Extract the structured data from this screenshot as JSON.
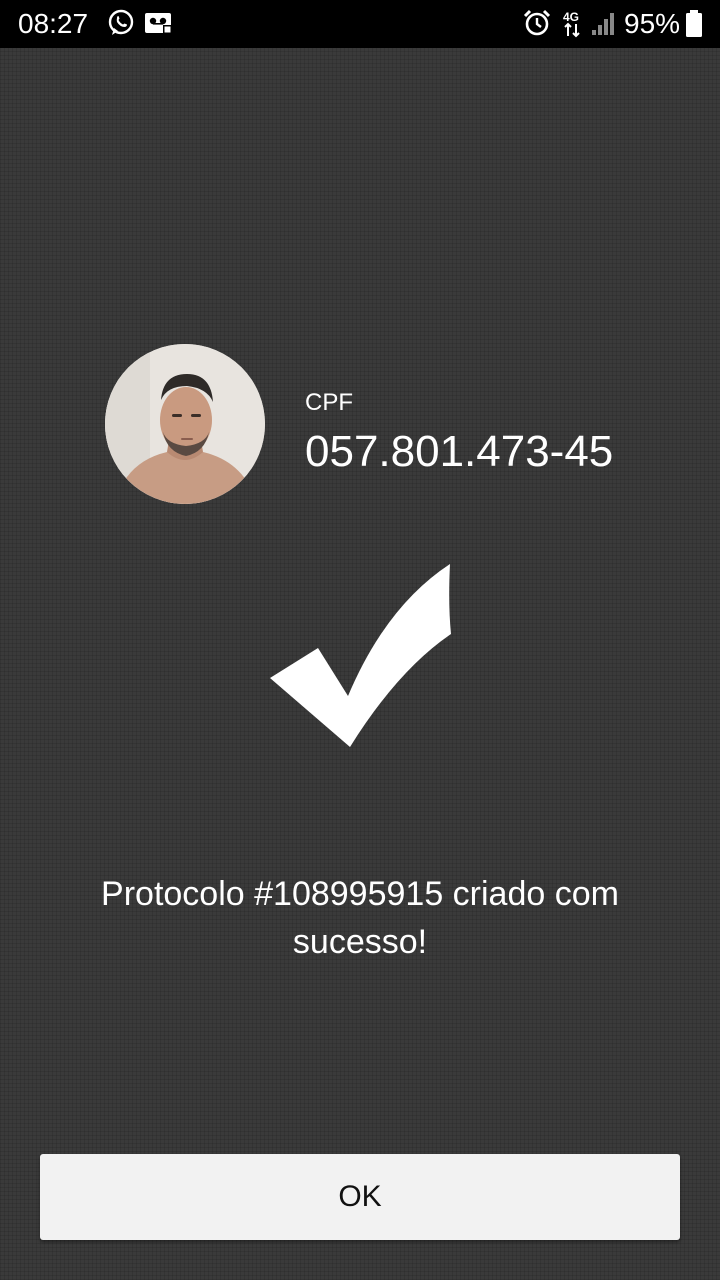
{
  "status_bar": {
    "time": "08:27",
    "battery": "95%",
    "network": "4G",
    "icons": [
      "whatsapp-icon",
      "voicemail-icon",
      "alarm-icon",
      "network-4g-icon",
      "signal-icon",
      "battery-icon"
    ]
  },
  "profile": {
    "avatar": "avatar",
    "cpf_label": "CPF",
    "cpf_value": "057.801.473-45"
  },
  "result": {
    "icon": "checkmark-icon",
    "message": "Protocolo #108995915 criado com sucesso!"
  },
  "actions": {
    "ok_label": "OK"
  },
  "colors": {
    "background": "#3a3a3a",
    "status_bar": "#000000",
    "text": "#ffffff",
    "button_bg": "#f2f2f2",
    "button_text": "#111111"
  }
}
